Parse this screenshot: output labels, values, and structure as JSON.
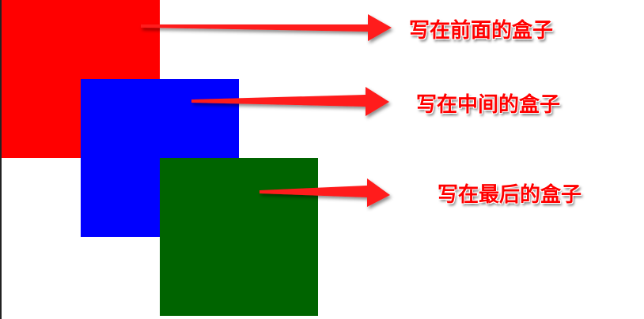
{
  "boxes": [
    {
      "id": "front",
      "color": "#ff0000",
      "label": "写在前面的盒子"
    },
    {
      "id": "middle",
      "color": "#0000ff",
      "label": "写在中间的盒子"
    },
    {
      "id": "back",
      "color": "#006400",
      "label": "写在最后的盒子"
    }
  ],
  "arrow_color": "#ff1a1a"
}
